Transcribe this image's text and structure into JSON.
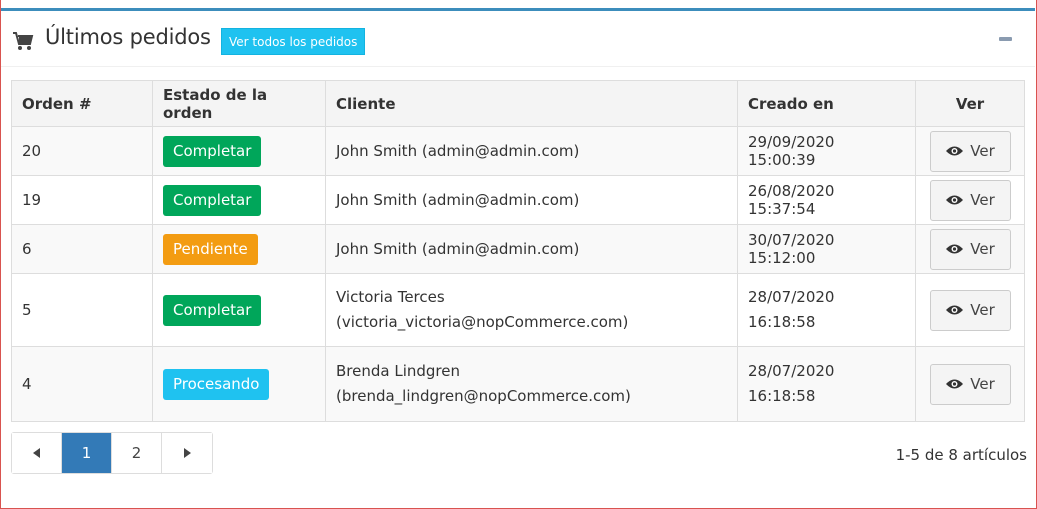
{
  "header": {
    "title": "Últimos pedidos",
    "view_all_label": "Ver todos los pedidos",
    "icon": "shopping-cart-icon",
    "collapse_icon": "minus-icon"
  },
  "table": {
    "columns": [
      "Orden #",
      "Estado de la orden",
      "Cliente",
      "Creado en",
      "Ver"
    ],
    "rows": [
      {
        "order": "20",
        "status": "Completar",
        "status_color": "#00a65a",
        "customer_name": "John Smith (admin@admin.com)",
        "customer_email": "",
        "created": "29/09/2020 15:00:39",
        "view": "Ver"
      },
      {
        "order": "19",
        "status": "Completar",
        "status_color": "#00a65a",
        "customer_name": "John Smith (admin@admin.com)",
        "customer_email": "",
        "created": "26/08/2020 15:37:54",
        "view": "Ver"
      },
      {
        "order": "6",
        "status": "Pendiente",
        "status_color": "#f39c12",
        "customer_name": "John Smith (admin@admin.com)",
        "customer_email": "",
        "created": "30/07/2020 15:12:00",
        "view": "Ver"
      },
      {
        "order": "5",
        "status": "Completar",
        "status_color": "#00a65a",
        "customer_name": "Victoria Terces",
        "customer_email": "(victoria_victoria@nopCommerce.com)",
        "created": "28/07/2020 16:18:58",
        "view": "Ver"
      },
      {
        "order": "4",
        "status": "Procesando",
        "status_color": "#1fc2f0",
        "customer_name": "Brenda Lindgren",
        "customer_email": "(brenda_lindgren@nopCommerce.com)",
        "created": "28/07/2020 16:18:58",
        "view": "Ver"
      }
    ]
  },
  "pagination": {
    "pages": [
      "1",
      "2"
    ],
    "current": "1",
    "info": "1-5 de 8 artículos"
  },
  "colors": {
    "accent": "#3c8dbc",
    "info": "#1fc2f0",
    "active_page": "#337ab7"
  }
}
